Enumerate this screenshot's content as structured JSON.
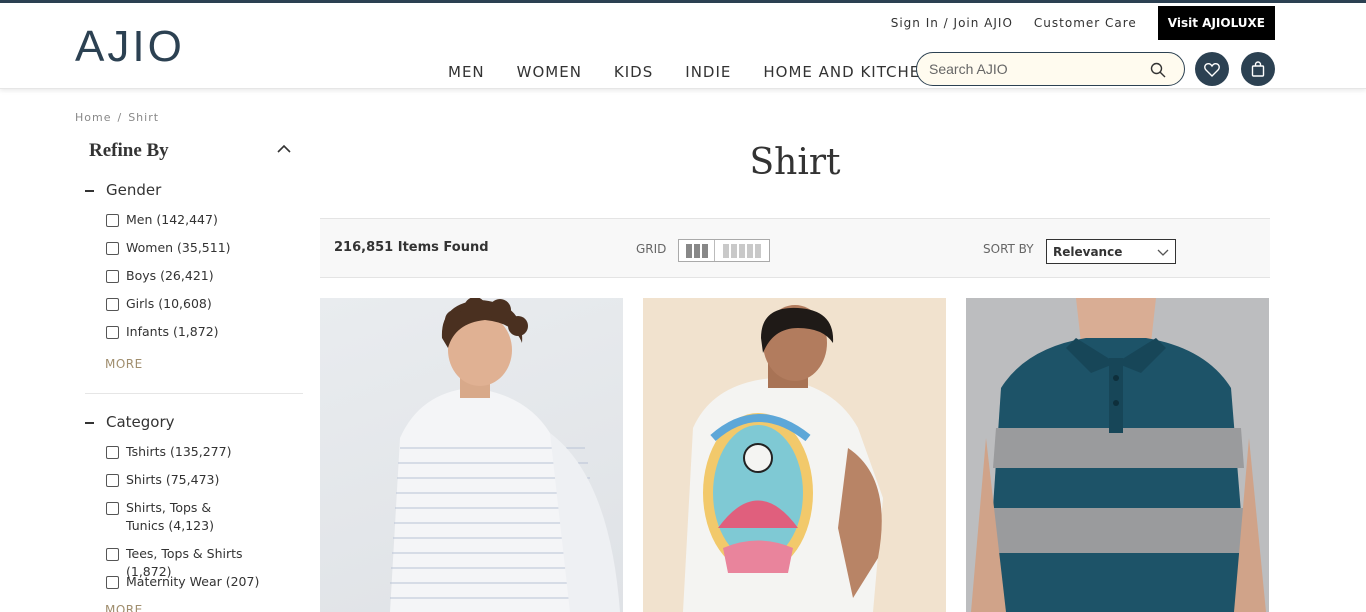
{
  "header": {
    "logo": "AJIO",
    "top_links": [
      "Sign In / Join AJIO",
      "Customer Care"
    ],
    "luxe_label": "Visit AJIOLUXE",
    "nav": [
      "MEN",
      "WOMEN",
      "KIDS",
      "INDIE",
      "HOME AND KITCHEN"
    ],
    "search_placeholder": "Search AJIO",
    "icons": [
      "search-icon",
      "heart-icon",
      "bag-icon"
    ]
  },
  "breadcrumb": [
    "Home",
    "Shirt"
  ],
  "sidebar": {
    "title": "Refine By",
    "facets": [
      {
        "title": "Gender",
        "options": [
          "Men (142,447)",
          "Women (35,511)",
          "Boys (26,421)",
          "Girls (10,608)",
          "Infants (1,872)"
        ],
        "more": "MORE"
      },
      {
        "title": "Category",
        "options": [
          "Tshirts (135,277)",
          "Shirts (75,473)",
          "Shirts, Tops & Tunics (4,123)",
          "Tees, Tops & Shirts (1,872)",
          "Maternity Wear (207)"
        ],
        "more": "MORE"
      }
    ]
  },
  "main": {
    "title": "Shirt",
    "items_found": "216,851 Items Found",
    "grid_label": "GRID",
    "sort_label": "SORT BY",
    "sort_value": "Relevance"
  },
  "colors": {
    "brand": "#2c4152",
    "search_bg": "#fffbef",
    "more_link": "#a08e6e"
  }
}
